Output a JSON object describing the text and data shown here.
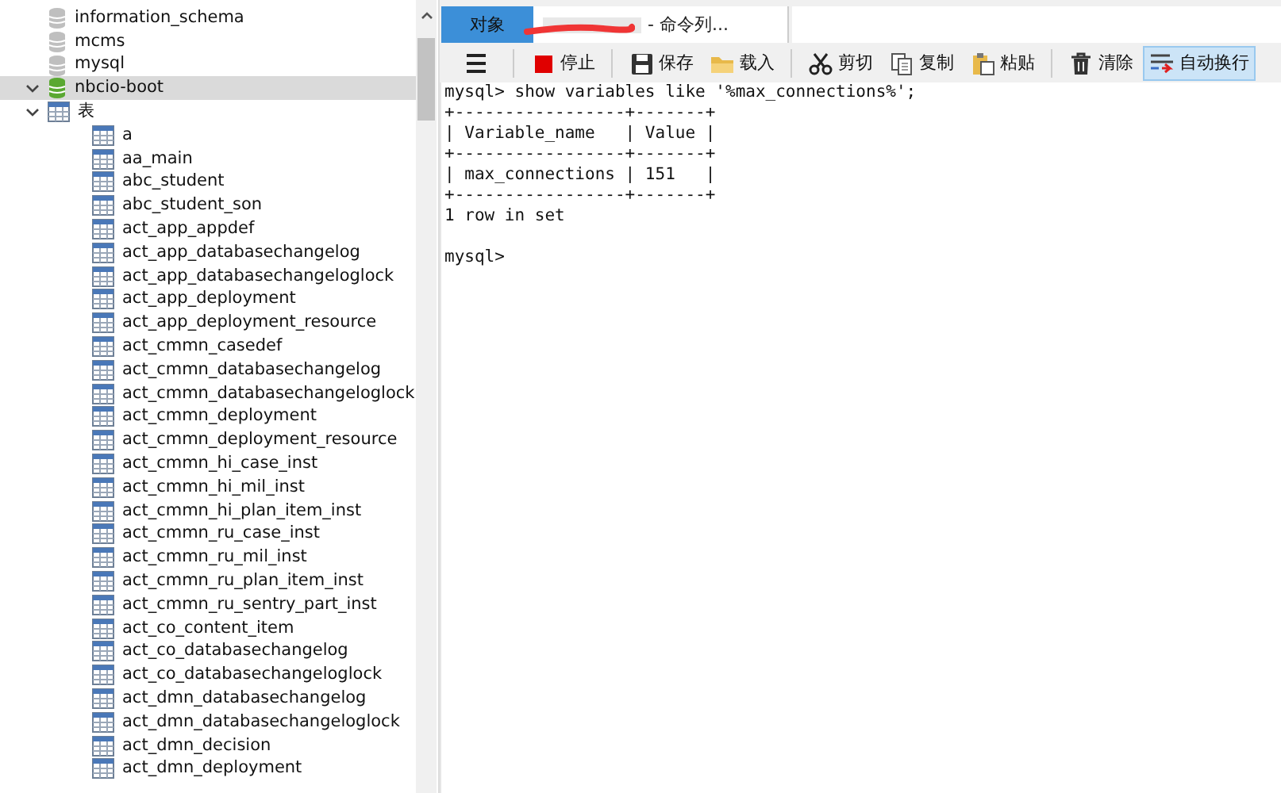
{
  "tree": [
    {
      "label": "information_schema",
      "kind": "database",
      "expanded": false,
      "selected": false
    },
    {
      "label": "mcms",
      "kind": "database",
      "expanded": false,
      "selected": false
    },
    {
      "label": "mysql",
      "kind": "database",
      "expanded": false,
      "selected": false
    },
    {
      "label": "nbcio-boot",
      "kind": "database-open",
      "expanded": true,
      "selected": true,
      "children": [
        {
          "label": "表",
          "kind": "tables",
          "expanded": true,
          "children": [
            {
              "label": "a",
              "kind": "table"
            },
            {
              "label": "aa_main",
              "kind": "table"
            },
            {
              "label": "abc_student",
              "kind": "table"
            },
            {
              "label": "abc_student_son",
              "kind": "table"
            },
            {
              "label": "act_app_appdef",
              "kind": "table"
            },
            {
              "label": "act_app_databasechangelog",
              "kind": "table"
            },
            {
              "label": "act_app_databasechangeloglock",
              "kind": "table"
            },
            {
              "label": "act_app_deployment",
              "kind": "table"
            },
            {
              "label": "act_app_deployment_resource",
              "kind": "table"
            },
            {
              "label": "act_cmmn_casedef",
              "kind": "table"
            },
            {
              "label": "act_cmmn_databasechangelog",
              "kind": "table"
            },
            {
              "label": "act_cmmn_databasechangeloglock",
              "kind": "table"
            },
            {
              "label": "act_cmmn_deployment",
              "kind": "table"
            },
            {
              "label": "act_cmmn_deployment_resource",
              "kind": "table"
            },
            {
              "label": "act_cmmn_hi_case_inst",
              "kind": "table"
            },
            {
              "label": "act_cmmn_hi_mil_inst",
              "kind": "table"
            },
            {
              "label": "act_cmmn_hi_plan_item_inst",
              "kind": "table"
            },
            {
              "label": "act_cmmn_ru_case_inst",
              "kind": "table"
            },
            {
              "label": "act_cmmn_ru_mil_inst",
              "kind": "table"
            },
            {
              "label": "act_cmmn_ru_plan_item_inst",
              "kind": "table"
            },
            {
              "label": "act_cmmn_ru_sentry_part_inst",
              "kind": "table"
            },
            {
              "label": "act_co_content_item",
              "kind": "table"
            },
            {
              "label": "act_co_databasechangelog",
              "kind": "table"
            },
            {
              "label": "act_co_databasechangeloglock",
              "kind": "table"
            },
            {
              "label": "act_dmn_databasechangelog",
              "kind": "table"
            },
            {
              "label": "act_dmn_databasechangeloglock",
              "kind": "table"
            },
            {
              "label": "act_dmn_decision",
              "kind": "table"
            },
            {
              "label": "act_dmn_deployment",
              "kind": "table"
            }
          ]
        }
      ]
    }
  ],
  "tabs": [
    {
      "label": "对象",
      "selected": true,
      "redacted": false
    },
    {
      "label": "- 命令列...",
      "selected": false,
      "redacted": true
    }
  ],
  "toolbar": [
    {
      "kind": "menu",
      "active": false
    },
    {
      "kind": "stop",
      "label": "停止",
      "active": false
    },
    {
      "kind": "save",
      "label": "保存",
      "active": false
    },
    {
      "kind": "load",
      "label": "载入",
      "active": false
    },
    {
      "kind": "cut",
      "label": "剪切",
      "active": false
    },
    {
      "kind": "copy",
      "label": "复制",
      "active": false
    },
    {
      "kind": "paste",
      "label": "粘贴",
      "active": false
    },
    {
      "kind": "clear",
      "label": "清除",
      "active": false
    },
    {
      "kind": "wrap",
      "label": "自动换行",
      "active": true
    }
  ],
  "console": [
    "mysql> show variables like '%max_connections%';",
    "+-----------------+-------+",
    "| Variable_name   | Value |",
    "+-----------------+-------+",
    "| max_connections | 151   |",
    "+-----------------+-------+",
    "1 row in set"
  ],
  "prompt": "mysql>"
}
